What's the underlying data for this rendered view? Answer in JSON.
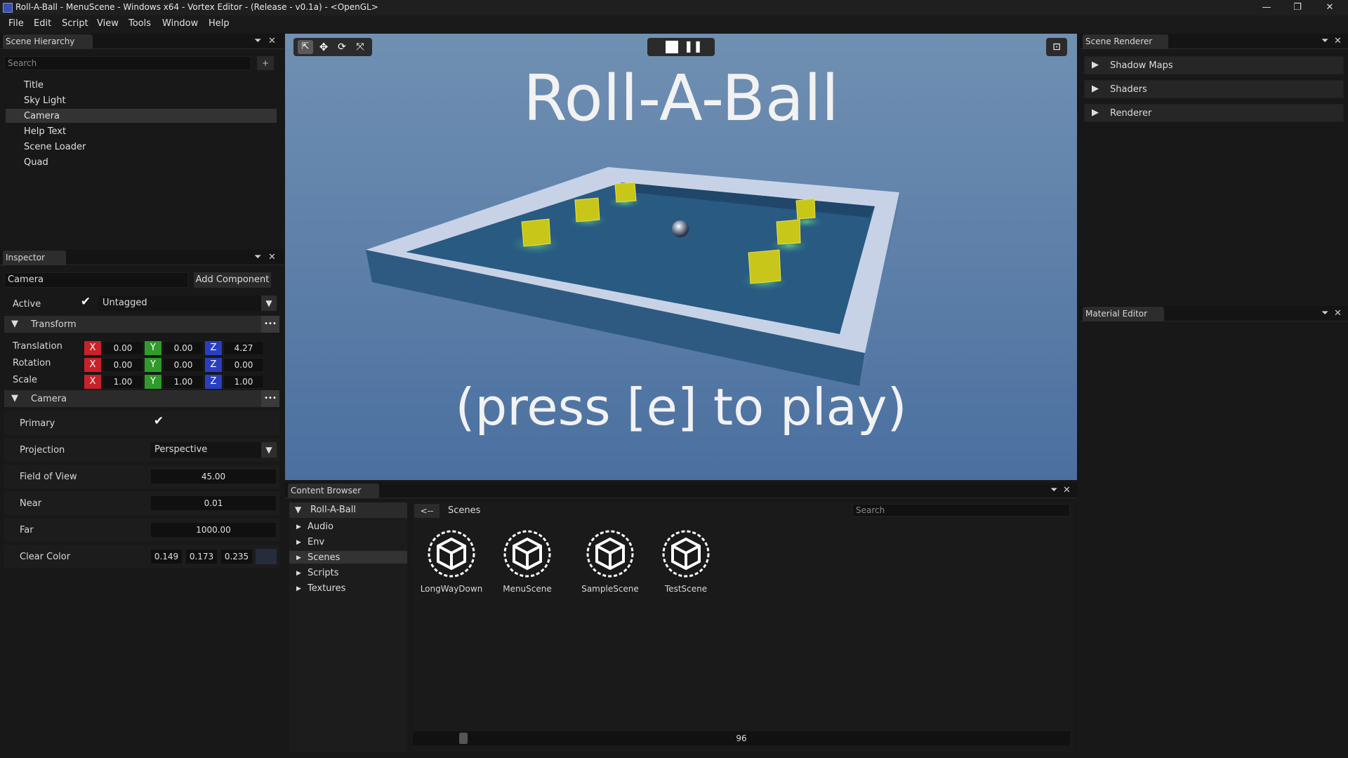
{
  "window": {
    "title": "Roll-A-Ball - MenuScene - Windows x64 - Vortex Editor - (Release - v0.1a) - <OpenGL>",
    "minimize": "—",
    "maximize": "❐",
    "close": "✕"
  },
  "menu": [
    "File",
    "Edit",
    "Script",
    "View",
    "Tools",
    "Window",
    "Help"
  ],
  "hierarchy": {
    "tab": "Scene Hierarchy",
    "search_placeholder": "Search",
    "add": "+",
    "items": [
      "Title",
      "Sky Light",
      "Camera",
      "Help Text",
      "Scene Loader",
      "Quad"
    ],
    "selected": "Camera"
  },
  "inspector": {
    "tab": "Inspector",
    "entity_name": "Camera",
    "add_component": "Add Component",
    "active_label": "Active",
    "tag": "Untagged",
    "transform": {
      "title": "Transform",
      "rows": [
        {
          "label": "Translation",
          "x": "0.00",
          "y": "0.00",
          "z": "4.27"
        },
        {
          "label": "Rotation",
          "x": "0.00",
          "y": "0.00",
          "z": "0.00"
        },
        {
          "label": "Scale",
          "x": "1.00",
          "y": "1.00",
          "z": "1.00"
        }
      ],
      "axis_labels": {
        "x": "X",
        "y": "Y",
        "z": "Z"
      }
    },
    "camera": {
      "title": "Camera",
      "primary_label": "Primary",
      "projection_label": "Projection",
      "projection_value": "Perspective",
      "fov_label": "Field of View",
      "fov_value": "45.00",
      "near_label": "Near",
      "near_value": "0.01",
      "far_label": "Far",
      "far_value": "1000.00",
      "clear_label": "Clear Color",
      "clear_r": "0.149",
      "clear_g": "0.173",
      "clear_b": "0.235",
      "clear_swatch": "#262c3c"
    },
    "more": "•••"
  },
  "viewport": {
    "title_text": "Roll-A-Ball",
    "subtitle_text": "(press [e] to play)",
    "sky_top": "#6f8fb0",
    "sky_bottom": "#4f73a0"
  },
  "content_browser": {
    "tab": "Content Browser",
    "root": "Roll-A-Ball",
    "folders": [
      "Audio",
      "Env",
      "Scenes",
      "Scripts",
      "Textures"
    ],
    "selected_folder": "Scenes",
    "back": "<--",
    "path": "Scenes",
    "search_placeholder": "Search",
    "assets": [
      "LongWayDown",
      "MenuScene",
      "SampleScene",
      "TestScene"
    ],
    "thumbnail_size": "96",
    "thumbnail_size_fraction": 0.07
  },
  "scene_renderer": {
    "tab": "Scene Renderer",
    "sections": [
      "Shadow Maps",
      "Shaders",
      "Renderer"
    ]
  },
  "material_editor": {
    "tab": "Material Editor"
  }
}
